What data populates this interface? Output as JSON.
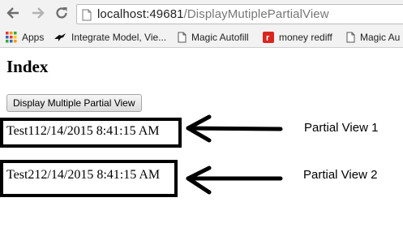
{
  "browser": {
    "url_host": "localhost:49681",
    "url_path": "/DisplayMutiplePartialView",
    "bookmarks": [
      {
        "label": "Apps",
        "icon": "apps-grid-icon"
      },
      {
        "label": "Integrate Model, Vie...",
        "icon": "bird-icon"
      },
      {
        "label": "Magic Autofill",
        "icon": "page-icon"
      },
      {
        "label": "money rediff",
        "icon": "rediff-icon"
      },
      {
        "label": "Magic Au",
        "icon": "page-icon"
      }
    ],
    "colors": {
      "rediff_red": "#d9261c"
    }
  },
  "page": {
    "title": "Index",
    "button_label": "Display Multiple Partial View",
    "partials": [
      {
        "text": "Test112/14/2015 8:41:15 AM",
        "annotation": "Partial View 1"
      },
      {
        "text": "Test212/14/2015 8:41:15 AM",
        "annotation": "Partial View 2"
      }
    ]
  }
}
